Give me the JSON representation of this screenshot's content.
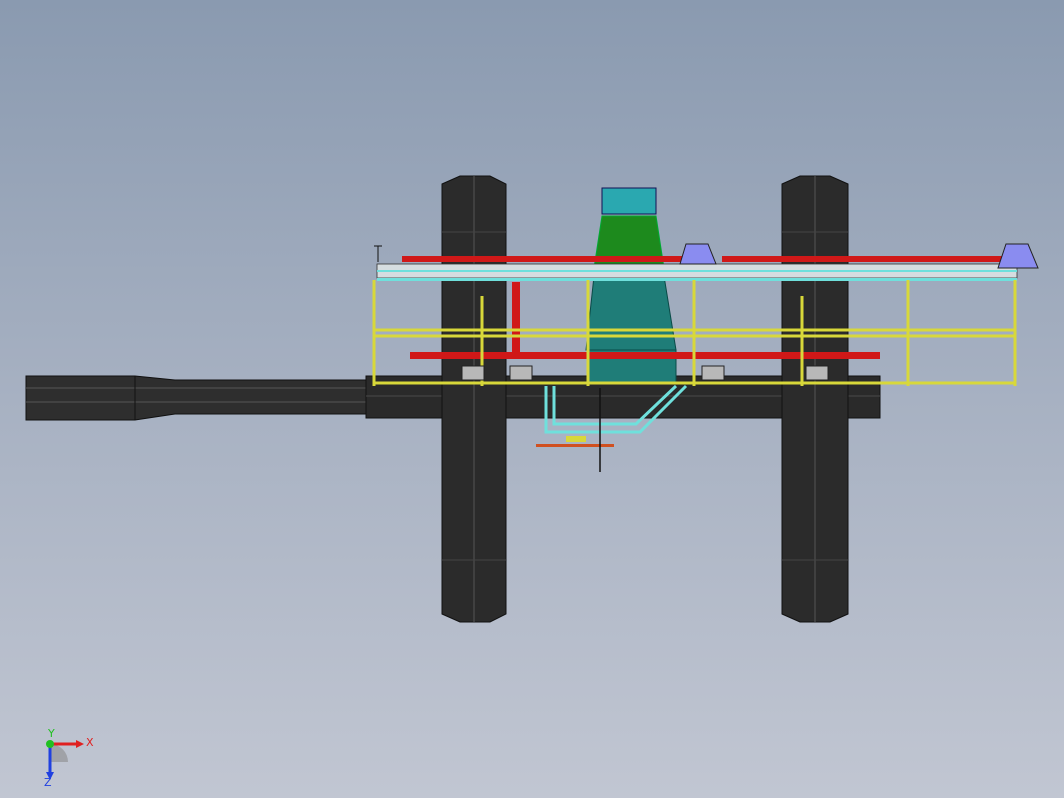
{
  "viewport": {
    "background_top": "#8a9ab0",
    "background_bottom": "#c1c6d2"
  },
  "model": {
    "colors": {
      "tire": "#2b2b2b",
      "frame": "#d8d83a",
      "beam_red": "#d01818",
      "cyan": "#6fe0dc",
      "hopper_green": "#1d8a1d",
      "hopper_teal": "#1f7d78",
      "cap_teal": "#2aa8b0",
      "blue_wedge": "#8a8cf0"
    }
  },
  "triad": {
    "x_label": "X",
    "y_label": "Y",
    "z_label": "Z",
    "x_color": "#e02020",
    "y_color": "#20c020",
    "z_color": "#2040e0"
  }
}
